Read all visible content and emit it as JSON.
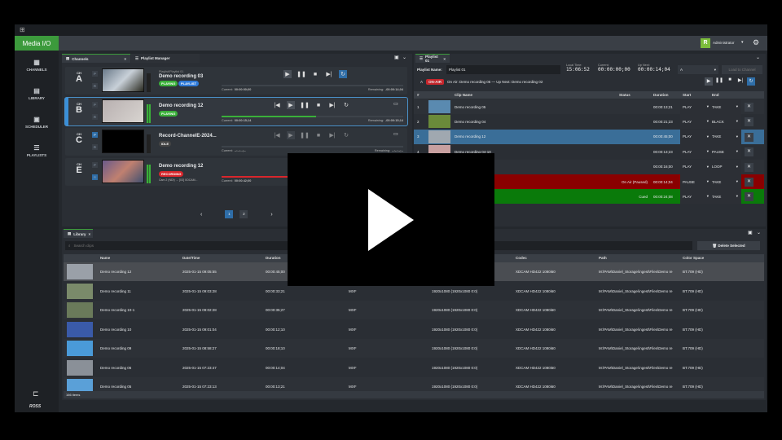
{
  "app": {
    "logo": "Media I/O",
    "user": "Administrator",
    "user_initial": "R",
    "brand": "ROSS",
    "accent": "#3c9a3c"
  },
  "sidebar": [
    {
      "label": "CHANNELS",
      "icon": "grid-icon"
    },
    {
      "label": "LIBRARY",
      "icon": "library-icon"
    },
    {
      "label": "SCHEDULER",
      "icon": "calendar-icon"
    },
    {
      "label": "PLAYLISTS",
      "icon": "playlist-icon"
    }
  ],
  "channels_panel": {
    "tabs": [
      "Channels",
      "Playlist Manager"
    ],
    "channels": [
      {
        "ch": "CH",
        "letter": "A",
        "sub": "Playlist/Playlist 01",
        "name": "Demo recording 03",
        "badges": [
          "PLAYING",
          "PLAYLIST"
        ],
        "current": "00:00:00;00",
        "remaining": "-00:00:14;04",
        "progress": 0,
        "current_label": "Current:",
        "remaining_label": "Remaining:"
      },
      {
        "ch": "CH",
        "letter": "B",
        "sub": "",
        "name": "Demo recording 12",
        "badges": [
          "PLAYING"
        ],
        "current": "00:00:15;14",
        "remaining": "-00:00:15;14",
        "progress": 52,
        "current_label": "Current:",
        "remaining_label": "Remaining:"
      },
      {
        "ch": "CH",
        "letter": "C",
        "sub": "",
        "name": "Record-ChannelE-2024...",
        "badges": [
          "IDLE"
        ],
        "current": "--:--:--;--",
        "remaining": "--:--:--;--",
        "progress": 0,
        "current_label": "Current:",
        "remaining_label": "Remaining:"
      },
      {
        "ch": "CH",
        "letter": "E",
        "sub": "Cam 2 (NDI) → [03] XDCAM...",
        "name": "Demo recording 12",
        "badges": [
          "RECORDING"
        ],
        "current": "00:00:42;00",
        "remaining": "",
        "progress": 95,
        "current_label": "Current:",
        "remaining_label": ""
      }
    ],
    "pages": [
      "1",
      "2"
    ],
    "prev": "‹",
    "next": "›"
  },
  "playlist": {
    "tab": "Playlist 01",
    "name_label": "Playlist Name:",
    "name": "Playlist 01",
    "local_time_label": "Local Time:",
    "local_time": "15:06:52",
    "current_label": "Current:",
    "current": "00:00:00;00",
    "upnext_label": "Up Next:",
    "upnext": "00:00:14;04",
    "channel_select": "A",
    "load_button": "Load to Channel",
    "onair_channel": "A",
    "onair_badge": "ON-AIR",
    "onair_text": "On Air: Demo recording 06  —  Up Next: Demo recording 02",
    "columns": [
      "#",
      "Clip Name",
      "Status",
      "Duration",
      "Start",
      "End"
    ],
    "rows": [
      {
        "n": "1",
        "name": "Demo recording 05",
        "status": "",
        "duration": "00:00:13;21",
        "start": "PLAY",
        "end": "TAKE"
      },
      {
        "n": "2",
        "name": "Demo recording 04",
        "status": "",
        "duration": "00:00:21;23",
        "start": "PLAY",
        "end": "BLACK"
      },
      {
        "n": "3",
        "name": "Demo recording 12",
        "status": "",
        "duration": "00:00:45;00",
        "start": "PLAY",
        "end": "TAKE"
      },
      {
        "n": "4",
        "name": "Demo recording 04-10",
        "status": "",
        "duration": "00:00:13;23",
        "start": "PLAY",
        "end": "PAUSE"
      },
      {
        "n": "5",
        "name": "Demo recording 10",
        "status": "",
        "duration": "00:00:16;00",
        "start": "PLAY",
        "end": "LOOP"
      },
      {
        "n": "6",
        "name": "Demo recording 06",
        "status": "On Air (Paused)",
        "duration": "00:00:14;04",
        "start": "PAUSE",
        "end": "TAKE"
      },
      {
        "n": "7",
        "name": "Demo recording 02",
        "status": "Cued",
        "duration": "00:00:24;08",
        "start": "PLAY",
        "end": "TAKE"
      }
    ]
  },
  "library": {
    "tab": "Library",
    "search_placeholder": "Search clips",
    "delete_button": "Delete Selected",
    "columns": [
      "Name",
      "Date/Time",
      "Duration",
      "Type",
      "Resolution",
      "Codec",
      "Path",
      "Color Space"
    ],
    "rows": [
      {
        "name": "Demo recording 12",
        "date": "2025-01-15 09:05:55",
        "duration": "00:00:45;00",
        "type": "MXF",
        "res": "1920x1080 (1920x1080 0:0)",
        "codec": "XDCAM HD422 1080i60",
        "path": "M:\\PAM\\Daniel_Storage\\ingest\\Files\\Demo re",
        "cs": "BT.709 (HD)"
      },
      {
        "name": "Demo recording 11",
        "date": "2025-01-15 09:03:28",
        "duration": "00:00:33;21",
        "type": "MXF",
        "res": "1920x1080 (1920x1080 0:0)",
        "codec": "XDCAM HD422 1080i60",
        "path": "M:\\PAM\\Daniel_Storage\\ingest\\Files\\Demo re",
        "cs": "BT.709 (HD)"
      },
      {
        "name": "Demo recording 10-1",
        "date": "2025-01-15 09:02:28",
        "duration": "00:00:35;27",
        "type": "MXF",
        "res": "1920x1080 (1920x1080 0:0)",
        "codec": "XDCAM HD422 1080i60",
        "path": "M:\\PAM\\Daniel_Storage\\ingest\\Files\\Demo re",
        "cs": "BT.709 (HD)"
      },
      {
        "name": "Demo recording 10",
        "date": "2025-01-15 09:01:04",
        "duration": "00:00:12;10",
        "type": "MXF",
        "res": "1920x1080 (1920x1080 0:0)",
        "codec": "XDCAM HD422 1080i60",
        "path": "M:\\PAM\\Daniel_Storage\\ingest\\Files\\Demo re",
        "cs": "BT.709 (HD)"
      },
      {
        "name": "Demo recording 09",
        "date": "2025-01-15 08:58:27",
        "duration": "00:00:18;10",
        "type": "MXF",
        "res": "1920x1080 (1920x1080 0:0)",
        "codec": "XDCAM HD422 1080i60",
        "path": "M:\\PAM\\Daniel_Storage\\ingest\\Files\\Demo re",
        "cs": "BT.709 (HD)"
      },
      {
        "name": "Demo recording 06",
        "date": "2025-01-15 07:23:47",
        "duration": "00:00:14;04",
        "type": "MXF",
        "res": "1920x1080 (1920x1080 0:0)",
        "codec": "XDCAM HD422 1080i60",
        "path": "M:\\PAM\\Daniel_Storage\\ingest\\Files\\Demo re",
        "cs": "BT.709 (HD)"
      },
      {
        "name": "Demo recording 05",
        "date": "2025-01-15 07:23:13",
        "duration": "00:00:13;21",
        "type": "MXF",
        "res": "1920x1080 (1920x1080 0:0)",
        "codec": "XDCAM HD422 1080i60",
        "path": "M:\\PAM\\Daniel_Storage\\ingest\\Files\\Demo re",
        "cs": "BT.709 (HD)"
      }
    ],
    "count": "166 items"
  }
}
